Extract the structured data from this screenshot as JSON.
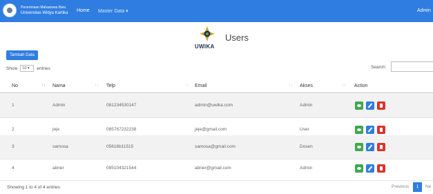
{
  "navbar": {
    "brand_line1": "Penerimaan Mahasiswa Baru",
    "brand_line2": "Universitas Widya Kartika",
    "home": "Home",
    "master_data": "Master Data ▾",
    "user": "Admin",
    "color": "#2f7de1"
  },
  "header": {
    "logo_text": "UWIKA",
    "title": "Users"
  },
  "toolbar": {
    "add_button": "Tambah Data"
  },
  "length_control": {
    "prefix": "Show",
    "value": "10 ▾",
    "suffix": "entries"
  },
  "search": {
    "label": "Search:",
    "value": ""
  },
  "table": {
    "columns": [
      "No",
      "Nama",
      "Telp",
      "Email",
      "Akses",
      "Action"
    ],
    "sort_icons": [
      "↑↓",
      "↑↓",
      "↑↓",
      "↑↓",
      "↑↓"
    ],
    "rows": [
      [
        "1",
        "Admin",
        "081234530147",
        "admin@uwika.com",
        "Admin"
      ],
      [
        "2",
        "jeje",
        "085767232238",
        "jeje@gmail.com",
        "User"
      ],
      [
        "3",
        "samosa",
        "05616b11515",
        "samosa@gmail.com",
        "Dosen"
      ],
      [
        "4",
        "abner",
        "085104321544",
        "abner@gmail.com",
        "Admin"
      ]
    ],
    "actions": [
      "eye-icon",
      "pencil-icon",
      "trash-icon"
    ]
  },
  "footer": {
    "info": "Showing 1 to 4 of 4 entries",
    "previous": "Previous",
    "current_page": "1",
    "next": "Ne"
  }
}
